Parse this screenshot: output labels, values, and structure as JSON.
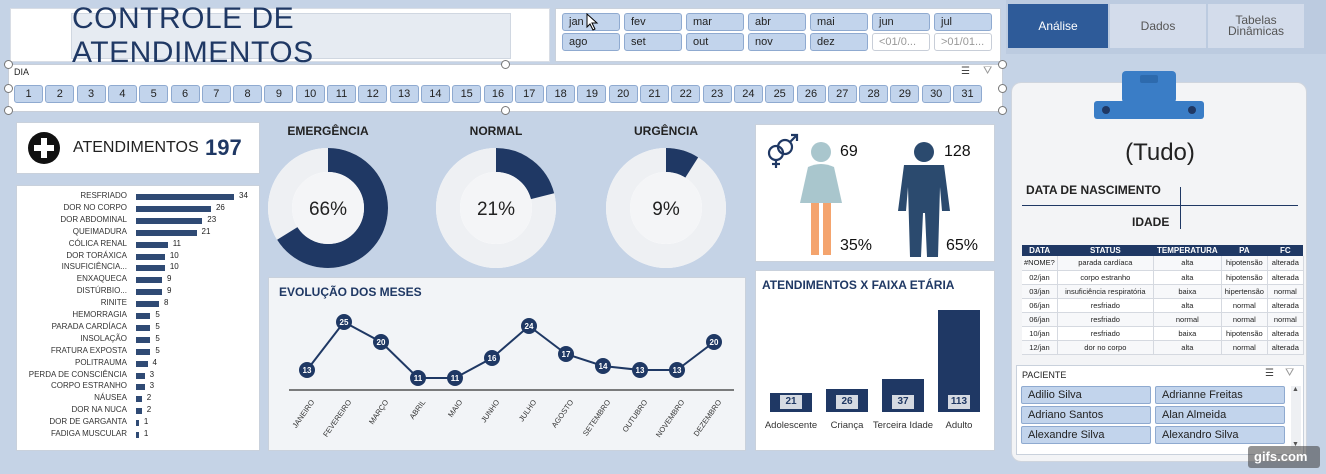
{
  "title": "CONTROLE DE ATENDIMENTOS",
  "months": [
    [
      "jan",
      "fev",
      "mar",
      "abr",
      "mai",
      "jun",
      "jul"
    ],
    [
      "ago",
      "set",
      "out",
      "nov",
      "dez",
      "<01/0...",
      ">01/01..."
    ]
  ],
  "day_slicer": {
    "label": "DIA",
    "days": [
      "1",
      "2",
      "3",
      "4",
      "5",
      "6",
      "7",
      "8",
      "9",
      "10",
      "11",
      "12",
      "13",
      "14",
      "15",
      "16",
      "17",
      "18",
      "19",
      "20",
      "21",
      "22",
      "23",
      "24",
      "25",
      "26",
      "27",
      "28",
      "29",
      "30",
      "31"
    ]
  },
  "tabs": [
    "Análise",
    "Dados",
    "Tabelas Dinâmicas"
  ],
  "attendances": {
    "label": "ATENDIMENTOS",
    "value": "197"
  },
  "donuts": [
    {
      "title": "EMERGÊNCIA",
      "label": "66%",
      "value": 0.66
    },
    {
      "title": "NORMAL",
      "label": "21%",
      "value": 0.21
    },
    {
      "title": "URGÊNCIA",
      "label": "9%",
      "value": 0.09
    }
  ],
  "gender": {
    "female_count": "69",
    "female_pct": "35%",
    "male_count": "128",
    "male_pct": "65%"
  },
  "colors": {
    "navy": "#1f3864",
    "bar": "#2f4a74",
    "female_top": "#a9c6cd",
    "female_legs": "#f4a46e",
    "male": "#2b4a6e"
  },
  "causes_chart": {
    "type": "bar",
    "categories": [
      "RESFRIADO",
      "DOR NO CORPO",
      "DOR ABDOMINAL",
      "QUEIMADURA",
      "CÓLICA RENAL",
      "DOR TORÁXICA",
      "INSUFICIÊNCIA...",
      "ENXAQUECA",
      "DISTÚRBIO...",
      "RINITE",
      "HEMORRAGIA",
      "PARADA CARDÍACA",
      "INSOLAÇÃO",
      "FRATURA EXPOSTA",
      "POLITRAUMA",
      "PERDA DE CONSCIÊNCIA",
      "CORPO ESTRANHO",
      "NÁUSEA",
      "DOR NA NUCA",
      "DOR DE GARGANTA",
      "FADIGA MUSCULAR"
    ],
    "values": [
      34,
      26,
      23,
      21,
      11,
      10,
      10,
      9,
      9,
      8,
      5,
      5,
      5,
      5,
      4,
      3,
      3,
      2,
      2,
      1,
      1
    ]
  },
  "months_chart": {
    "type": "line",
    "title": "EVOLUÇÃO DOS MESES",
    "categories": [
      "JANEIRO",
      "FEVEREIRO",
      "MARÇO",
      "ABRIL",
      "MAIO",
      "JUNHO",
      "JULHO",
      "AGOSTO",
      "SETEMBRO",
      "OUTUBRO",
      "NOVEMBRO",
      "DEZEMBRO"
    ],
    "values": [
      13,
      25,
      20,
      11,
      11,
      16,
      24,
      17,
      14,
      13,
      13,
      20
    ]
  },
  "age_chart": {
    "type": "bar",
    "title": "ATENDIMENTOS X FAIXA ETÁRIA",
    "categories": [
      "Adolescente",
      "Criança",
      "Terceira Idade",
      "Adulto"
    ],
    "values": [
      21,
      26,
      37,
      113
    ]
  },
  "patient_card": {
    "name": "(Tudo)",
    "birth_label": "DATA DE NASCIMENTO",
    "age_label": "IDADE"
  },
  "records": {
    "headers": [
      "DATA",
      "STATUS",
      "TEMPERATURA",
      "PA",
      "FC"
    ],
    "rows": [
      [
        "#NOME?",
        "parada cardíaca",
        "alta",
        "hipotensão",
        "alterada"
      ],
      [
        "02/jan",
        "corpo estranho",
        "alta",
        "hipotensão",
        "alterada"
      ],
      [
        "03/jan",
        "insuficiência respiratória",
        "baixa",
        "hipertensão",
        "normal"
      ],
      [
        "06/jan",
        "resfriado",
        "alta",
        "normal",
        "alterada"
      ],
      [
        "06/jan",
        "resfriado",
        "normal",
        "normal",
        "normal"
      ],
      [
        "10/jan",
        "resfriado",
        "baixa",
        "hipotensão",
        "alterada"
      ],
      [
        "12/jan",
        "dor no corpo",
        "alta",
        "normal",
        "alterada"
      ]
    ]
  },
  "patients": {
    "label": "PACIENTE",
    "names": [
      "Adilio Silva",
      "Adrianne Freitas",
      "Adriano Santos",
      "Alan Almeida",
      "Alexandre Silva",
      "Alexandro Silva"
    ]
  },
  "watermark": "gifs.com"
}
